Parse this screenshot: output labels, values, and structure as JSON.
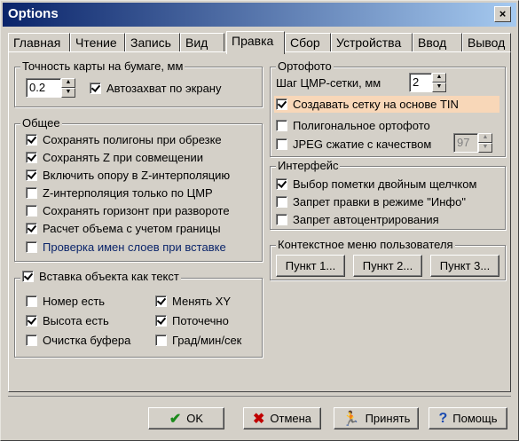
{
  "window": {
    "title": "Options",
    "close": "×"
  },
  "tabs": [
    "Главная",
    "Чтение",
    "Запись",
    "Вид",
    "Правка",
    "Сбор",
    "Устройства",
    "Ввод",
    "Вывод"
  ],
  "active_tab": "Правка",
  "accuracy": {
    "title": "Точность карты на бумаге, мм",
    "value": "0.2",
    "autosnap": "Автозахват по экрану",
    "autosnap_checked": true
  },
  "general": {
    "title": "Общее",
    "items": [
      {
        "label": "Сохранять полигоны при обрезке",
        "checked": true
      },
      {
        "label": "Сохранять Z при совмещении",
        "checked": true
      },
      {
        "label": "Включить опору в Z-интерполяцию",
        "checked": true
      },
      {
        "label": "Z-интерполяция только по ЦМР",
        "checked": false
      },
      {
        "label": "Сохранять горизонт при развороте",
        "checked": false
      },
      {
        "label": "Расчет объема с учетом границы",
        "checked": true
      },
      {
        "label": "Проверка имен слоев при вставке",
        "checked": false
      }
    ]
  },
  "insert": {
    "title": "Вставка объекта как текст",
    "title_checked": true,
    "left": [
      {
        "label": "Номер есть",
        "checked": false
      },
      {
        "label": "Высота есть",
        "checked": true
      },
      {
        "label": "Очистка буфера",
        "checked": false
      }
    ],
    "right": [
      {
        "label": "Менять XY",
        "checked": true
      },
      {
        "label": "Поточечно",
        "checked": true
      },
      {
        "label": "Град/мин/сек",
        "checked": false
      }
    ]
  },
  "ortho": {
    "title": "Ортофото",
    "step_label": "Шаг ЦМР-сетки, мм",
    "step_value": "2",
    "tin": {
      "label": "Создавать сетку на основе TIN",
      "checked": true
    },
    "polygonal": {
      "label": "Полигональное ортофото",
      "checked": false
    },
    "jpeg": {
      "label": "JPEG сжатие с качеством",
      "checked": false,
      "value": "97"
    }
  },
  "interface": {
    "title": "Интерфейс",
    "items": [
      {
        "label": "Выбор пометки двойным щелчком",
        "checked": true
      },
      {
        "label": "Запрет правки в режиме \"Инфо\"",
        "checked": false
      },
      {
        "label": "Запрет автоцентрирования",
        "checked": false
      }
    ]
  },
  "context_menu": {
    "title": "Контекстное меню пользователя",
    "buttons": [
      "Пункт 1...",
      "Пункт 2...",
      "Пункт 3..."
    ]
  },
  "footer": {
    "ok": "OK",
    "cancel": "Отмена",
    "apply": "Принять",
    "help": "Помощь"
  },
  "icons": {
    "ok": "check-icon",
    "cancel": "x-icon",
    "apply": "running-man-icon",
    "help": "question-icon"
  },
  "colors": {
    "title_start": "#0a246a",
    "title_end": "#a6caf0",
    "highlight": "#f8d7b8",
    "ok_green": "#1a8a1a",
    "cancel_red": "#c00000",
    "help_blue": "#1a4ab0"
  }
}
